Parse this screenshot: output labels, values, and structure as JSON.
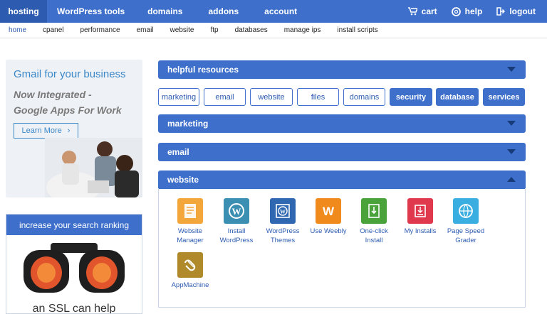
{
  "topnav": {
    "tabs": [
      "hosting",
      "WordPress tools",
      "domains",
      "addons",
      "account"
    ],
    "right": {
      "cart": "cart",
      "help": "help",
      "logout": "logout"
    }
  },
  "subnav": [
    "home",
    "cpanel",
    "performance",
    "email",
    "website",
    "ftp",
    "databases",
    "manage ips",
    "install scripts"
  ],
  "gmail_ad": {
    "title": "Gmail for your business",
    "tagline_1": "Now Integrated -",
    "tagline_2": "Google Apps For Work",
    "button": "Learn More",
    "button_glyph": "›"
  },
  "ssl_ad": {
    "header": "increase your search ranking",
    "caption": "an SSL can help"
  },
  "panels": {
    "helpful_resources": "helpful resources",
    "marketing": "marketing",
    "email": "email",
    "website": "website"
  },
  "resource_buttons": [
    "marketing",
    "email",
    "website",
    "files",
    "domains",
    "security",
    "database",
    "services"
  ],
  "website_tools": [
    {
      "label": "Website\nManager",
      "color": "#f3a73a",
      "icon": "website-manager-icon"
    },
    {
      "label": "Install\nWordPress",
      "color": "#3b8fb3",
      "icon": "wordpress-icon"
    },
    {
      "label": "WordPress\nThemes",
      "color": "#2f68b0",
      "icon": "wordpress-themes-icon"
    },
    {
      "label": "Use Weebly",
      "color": "#f08a1c",
      "icon": "weebly-icon"
    },
    {
      "label": "One-click\nInstall",
      "color": "#4aa23a",
      "icon": "one-click-install-icon"
    },
    {
      "label": "My Installs",
      "color": "#e0394e",
      "icon": "my-installs-icon"
    },
    {
      "label": "Page Speed\nGrader",
      "color": "#3aaee0",
      "icon": "page-speed-icon"
    },
    {
      "label": "AppMachine",
      "color": "#b08a2a",
      "icon": "appmachine-icon"
    }
  ]
}
